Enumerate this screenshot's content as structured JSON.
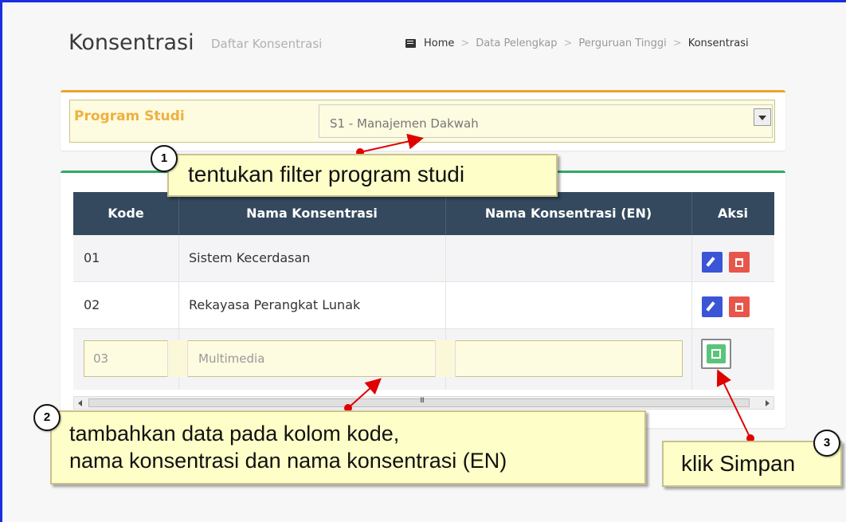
{
  "header": {
    "title": "Konsentrasi",
    "subtitle": "Daftar Konsentrasi",
    "breadcrumb": [
      "Home",
      "Data Pelengkap",
      "Perguruan Tinggi",
      "Konsentrasi"
    ],
    "breadcrumb_separator": ">"
  },
  "filter": {
    "label": "Program Studi",
    "selected": "S1 - Manajemen Dakwah"
  },
  "table": {
    "columns": [
      "Kode",
      "Nama Konsentrasi",
      "Nama Konsentrasi (EN)",
      "Aksi"
    ],
    "rows": [
      {
        "kode": "01",
        "nama": "Sistem Kecerdasan",
        "nama_en": ""
      },
      {
        "kode": "02",
        "nama": "Rekayasa Perangkat Lunak",
        "nama_en": ""
      }
    ],
    "new_row": {
      "kode": "03",
      "nama": "Multimedia",
      "nama_en": ""
    },
    "scroll_mid_label": "III"
  },
  "annotations": {
    "step1": {
      "number": "1",
      "text": "tentukan filter program studi"
    },
    "step2": {
      "number": "2",
      "line1": "tambahkan data pada kolom kode,",
      "line2": "nama konsentrasi dan nama konsentrasi (EN)"
    },
    "step3": {
      "number": "3",
      "text": "klik Simpan"
    }
  },
  "colors": {
    "frame_border": "#1a2fe0",
    "table_header": "#34495e",
    "edit_button": "#3a55d6",
    "delete_button": "#e8554a",
    "save_button": "#5bc47a",
    "filter_label": "#f0b040",
    "callout_bg": "#fefec8",
    "arrow": "#e00000"
  }
}
